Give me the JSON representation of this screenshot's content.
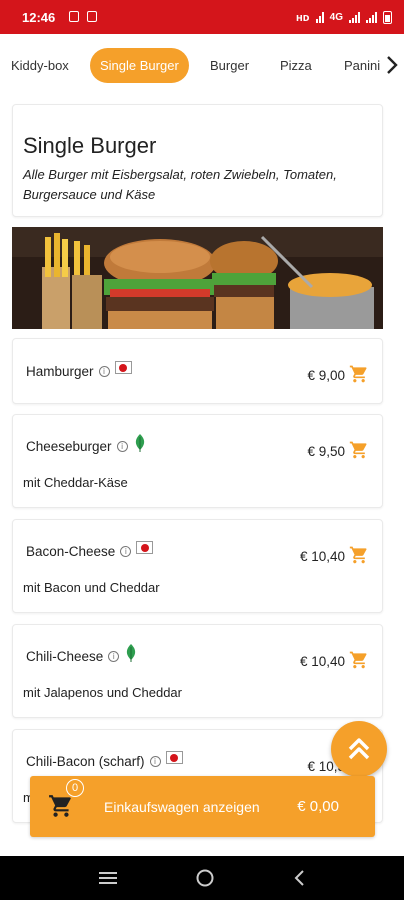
{
  "status_bar": {
    "time": "12:46",
    "network": "4G"
  },
  "categories": [
    {
      "label": "Kiddy-box",
      "active": false
    },
    {
      "label": "Single Burger",
      "active": true
    },
    {
      "label": "Burger",
      "active": false
    },
    {
      "label": "Pizza",
      "active": false
    },
    {
      "label": "Panini",
      "active": false
    }
  ],
  "section": {
    "title": "Single Burger",
    "description": "Alle Burger mit Eisbergsalat, roten Zwiebeln, Tomaten, Burgersauce und Käse"
  },
  "products": [
    {
      "name": "Hamburger",
      "subtitle": "",
      "price": "€ 9,00",
      "badge": "flag-icon"
    },
    {
      "name": "Cheeseburger",
      "subtitle": "mit Cheddar-Käse",
      "price": "€ 9,50",
      "badge": "leaf-icon"
    },
    {
      "name": "Bacon-Cheese",
      "subtitle": "mit Bacon und Cheddar",
      "price": "€ 10,40",
      "badge": "flag-icon"
    },
    {
      "name": "Chili-Cheese",
      "subtitle": "mit Jalapenos und Cheddar",
      "price": "€ 10,40",
      "badge": "leaf-icon"
    },
    {
      "name": "Chili-Bacon (scharf)",
      "subtitle": "m",
      "price": "€ 10,5",
      "badge": "flag-icon"
    }
  ],
  "cart": {
    "count": "0",
    "label": "Einkaufswagen anzeigen",
    "total": "€ 0,00"
  },
  "colors": {
    "accent": "#f5a02a",
    "status_bar": "#d4151b",
    "leaf": "#2e9e4f"
  }
}
